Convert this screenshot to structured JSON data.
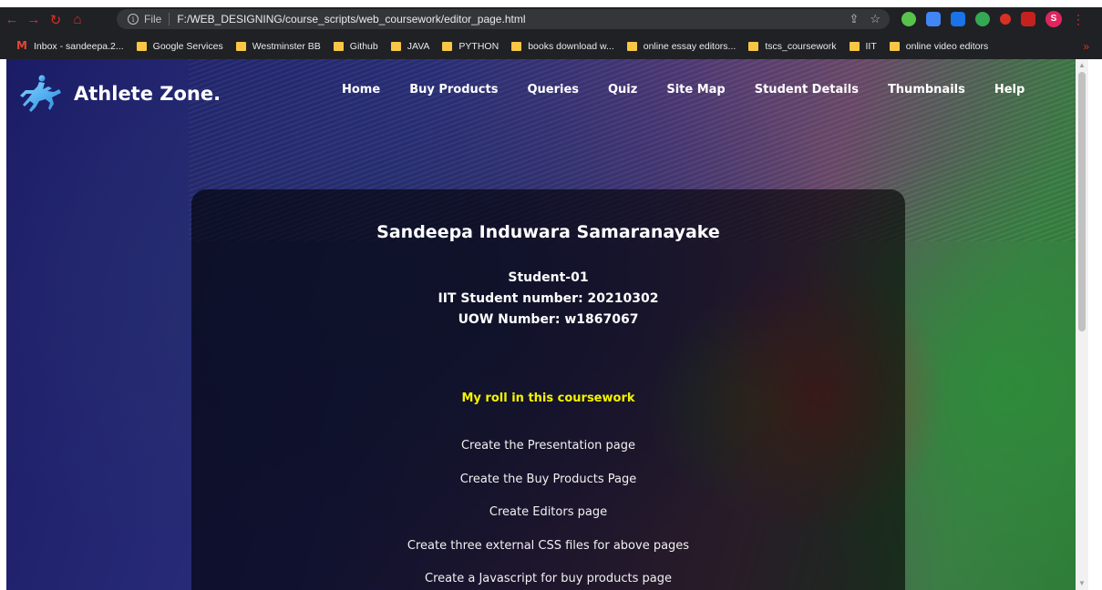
{
  "browser": {
    "scheme": "File",
    "url": "F:/WEB_DESIGNING/course_scripts/web_coursework/editor_page.html",
    "profile_initial": "S",
    "bookmarks": [
      "Inbox - sandeepa.2...",
      "Google Services",
      "Westminster BB",
      "Github",
      "JAVA",
      "PYTHON",
      "books download w...",
      "online essay editors...",
      "tscs_coursework",
      "IIT",
      "online video editors"
    ]
  },
  "site": {
    "logo_text": "Athlete Zone.",
    "nav": [
      "Home",
      "Buy Products",
      "Queries",
      "Quiz",
      "Site Map",
      "Student Details",
      "Thumbnails",
      "Help"
    ]
  },
  "card": {
    "name": "Sandeepa Induwara Samaranayake",
    "student_label": "Student-01",
    "iit_number": "IIT Student number: 20210302",
    "uow_number": "UOW Number: w1867067",
    "roles_title": "My roll in this coursework",
    "roles": [
      "Create the Presentation page",
      "Create the Buy Products Page",
      "Create Editors page",
      "Create three external CSS files for above pages",
      "Create a Javascript for buy products page"
    ]
  },
  "colors": {
    "roles_title": "#f4f400",
    "chrome": "#202124"
  }
}
